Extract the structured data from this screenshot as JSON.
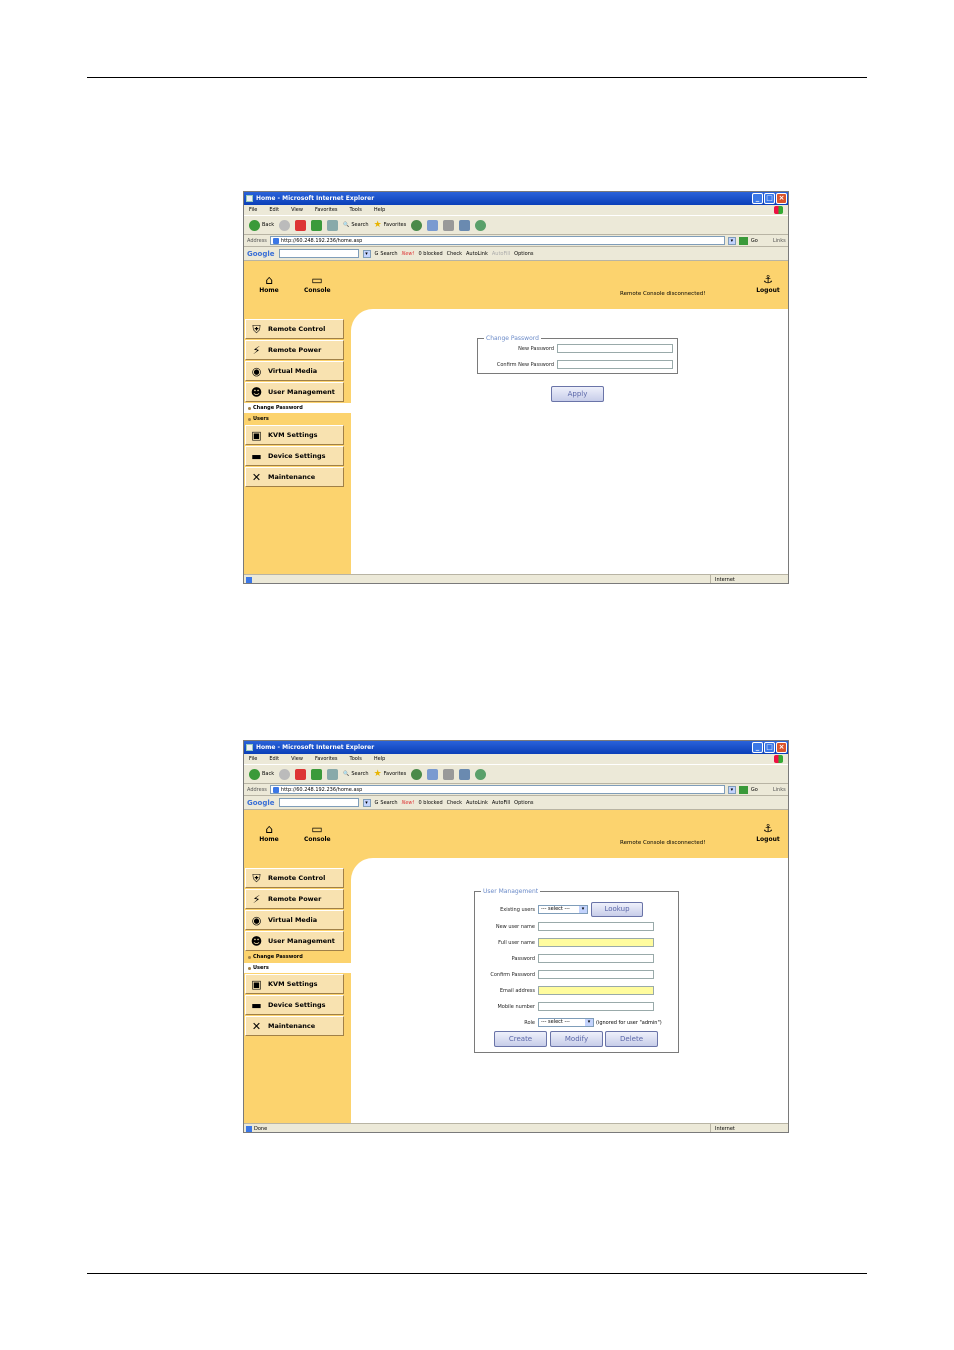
{
  "browser": {
    "title": "Home - Microsoft Internet Explorer",
    "menu": [
      "File",
      "Edit",
      "View",
      "Favorites",
      "Tools",
      "Help"
    ],
    "toolbar": {
      "back": "Back",
      "search": "Search",
      "favorites": "Favorites"
    },
    "address_label": "Address",
    "url": "http://60.248.192.236/home.asp",
    "go": "Go",
    "links": "Links",
    "google": {
      "logo": "Google",
      "search": "Search",
      "new_badge": "New!",
      "blocked": "0 blocked",
      "check": "Check",
      "autolink": "AutoLink",
      "autofill": "AutoFill",
      "options": "Options"
    },
    "zone": "Internet"
  },
  "app": {
    "nav": {
      "home": "Home",
      "console": "Console",
      "logout": "Logout"
    },
    "status": "Remote Console disconnected!",
    "menu": {
      "remote_control": "Remote Control",
      "remote_power": "Remote Power",
      "virtual_media": "Virtual Media",
      "user_management": "User Management",
      "sub_change_password": "Change Password",
      "sub_users": "Users",
      "kvm_settings": "KVM Settings",
      "device_settings": "Device Settings",
      "maintenance": "Maintenance"
    }
  },
  "shot1": {
    "legend": "Change Password",
    "new_password": "New Password",
    "confirm_new_password": "Confirm New Password",
    "apply": "Apply"
  },
  "shot2": {
    "status_bar": "Done",
    "legend": "User Management",
    "existing_users": "Existing users",
    "select_placeholder": "--- select ---",
    "lookup": "Lookup",
    "new_user_name": "New user name",
    "full_user_name": "Full user name",
    "password": "Password",
    "confirm_password": "Confirm Password",
    "email_address": "Email address",
    "mobile_number": "Mobile number",
    "role": "Role",
    "role_note": "(ignored for user \"admin\")",
    "create": "Create",
    "modify": "Modify",
    "delete": "Delete"
  },
  "colors": {
    "sidebar": "#fcd36e",
    "titlebar": "#0a3fb8",
    "legend": "#6a8ac8",
    "required_field": "#fffc9e"
  }
}
